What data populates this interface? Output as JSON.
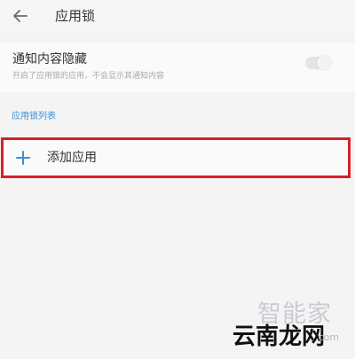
{
  "header": {
    "title": "应用锁",
    "back_icon": "arrow-left-icon"
  },
  "setting": {
    "title": "通知内容隐藏",
    "subtitle": "开启了应用锁的应用，不会显示其通知内容",
    "toggle_on": false
  },
  "section": {
    "label": "应用锁列表"
  },
  "add_app": {
    "label": "添加应用",
    "icon": "plus-icon"
  },
  "watermark": {
    "top": "智能家",
    "bottom": "云南龙网",
    "suffix": ".com"
  },
  "colors": {
    "accent": "#3c8fd6",
    "highlight_border": "#d81f2a",
    "background": "#f4f4f4"
  }
}
